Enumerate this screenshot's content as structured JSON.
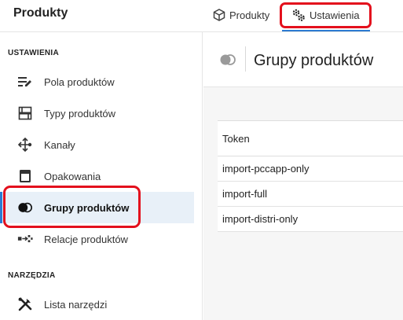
{
  "header": {
    "app_title": "Produkty",
    "tabs": [
      {
        "label": "Produkty",
        "icon": "cube-icon"
      },
      {
        "label": "Ustawienia",
        "icon": "gears-icon",
        "active": true
      }
    ]
  },
  "sidebar": {
    "sections": [
      {
        "title": "USTAWIENIA",
        "items": [
          {
            "label": "Pola produktów",
            "icon": "fields-edit-icon"
          },
          {
            "label": "Typy produktów",
            "icon": "product-types-icon"
          },
          {
            "label": "Kanały",
            "icon": "channels-arrows-icon"
          },
          {
            "label": "Opakowania",
            "icon": "package-icon"
          },
          {
            "label": "Grupy produktów",
            "icon": "product-groups-icon",
            "active": true
          },
          {
            "label": "Relacje produktów",
            "icon": "relations-icon"
          }
        ]
      },
      {
        "title": "NARZĘDZIA",
        "items": [
          {
            "label": "Lista narzędzi",
            "icon": "tools-icon"
          }
        ]
      }
    ]
  },
  "main": {
    "title": "Grupy produktów",
    "table": {
      "columns": [
        "Token"
      ],
      "rows": [
        "import-pccapp-only",
        "import-full",
        "import-distri-only"
      ]
    }
  },
  "colors": {
    "accent": "#2d7bd1",
    "highlight_box": "#e3101d",
    "active_bg": "#e8f0f8"
  }
}
